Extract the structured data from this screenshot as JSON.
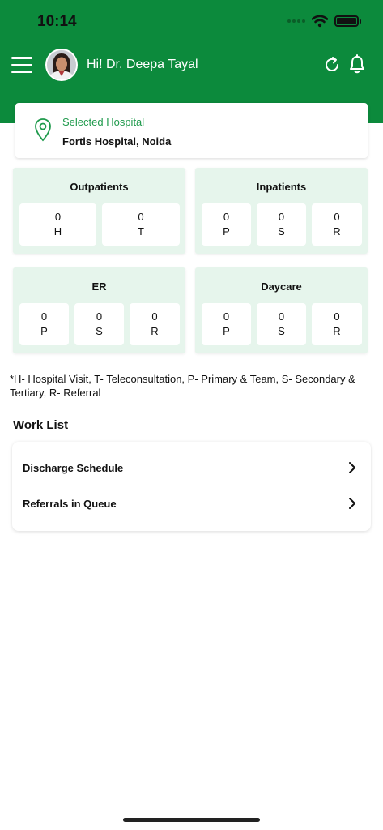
{
  "status_bar": {
    "time": "10:14"
  },
  "header": {
    "greeting": "Hi! Dr. Deepa Tayal",
    "accent_color": "#0c8a3c"
  },
  "hospital": {
    "label": "Selected Hospital",
    "name": "Fortis Hospital, Noida"
  },
  "stats": {
    "outpatients": {
      "title": "Outpatients",
      "cells": [
        {
          "value": "0",
          "key": "H"
        },
        {
          "value": "0",
          "key": "T"
        }
      ]
    },
    "inpatients": {
      "title": "Inpatients",
      "cells": [
        {
          "value": "0",
          "key": "P"
        },
        {
          "value": "0",
          "key": "S"
        },
        {
          "value": "0",
          "key": "R"
        }
      ]
    },
    "er": {
      "title": "ER",
      "cells": [
        {
          "value": "0",
          "key": "P"
        },
        {
          "value": "0",
          "key": "S"
        },
        {
          "value": "0",
          "key": "R"
        }
      ]
    },
    "daycare": {
      "title": "Daycare",
      "cells": [
        {
          "value": "0",
          "key": "P"
        },
        {
          "value": "0",
          "key": "S"
        },
        {
          "value": "0",
          "key": "R"
        }
      ]
    }
  },
  "legend": "*H- Hospital Visit, T- Teleconsultation, P- Primary & Team, S- Secondary & Tertiary, R- Referral",
  "worklist": {
    "title": "Work List",
    "items": [
      {
        "label": "Discharge Schedule"
      },
      {
        "label": "Referrals in Queue"
      }
    ]
  },
  "icons": {
    "menu": "hamburger-menu-icon",
    "refresh": "refresh-icon",
    "notifications": "bell-icon",
    "location": "location-pin-icon",
    "chevron": "chevron-right-icon"
  }
}
